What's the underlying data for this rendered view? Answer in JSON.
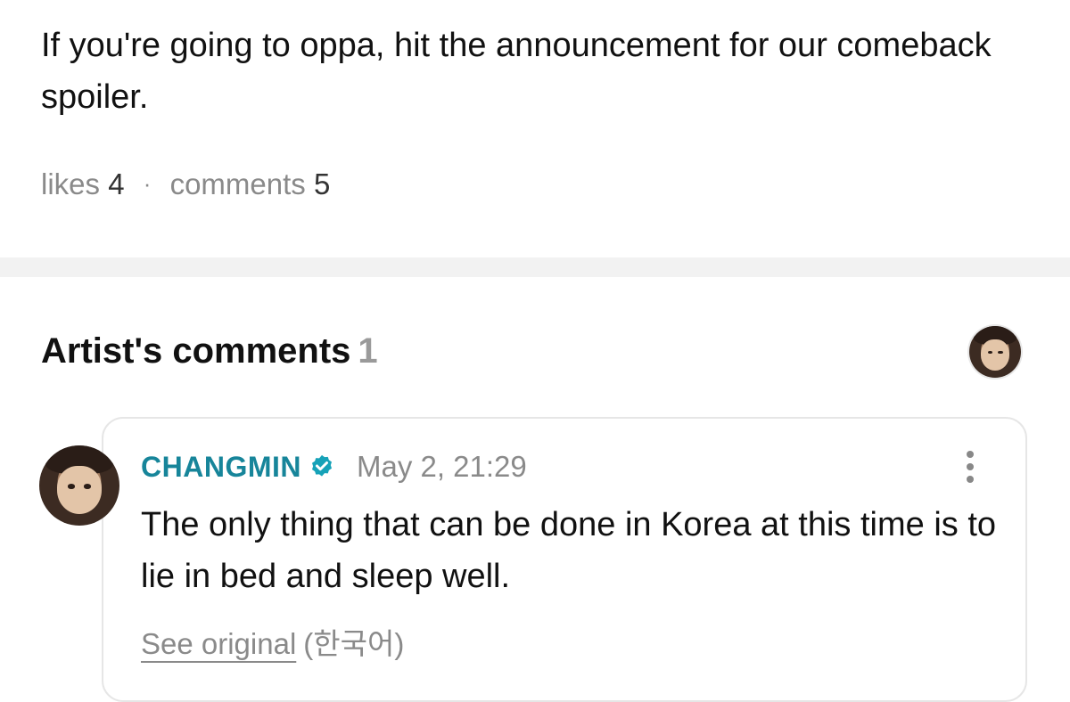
{
  "post": {
    "text": "If you're going to oppa, hit the announcement for our comeback spoiler.",
    "likes_label": "likes",
    "likes_count": "4",
    "separator": "·",
    "comments_label": "comments",
    "comments_count": "5"
  },
  "artist_comments": {
    "title": "Artist's comments",
    "count": "1",
    "comment": {
      "author": "CHANGMIN",
      "verified_icon": "verified-badge-icon",
      "timestamp": "May 2, 21:29",
      "text": "The only thing that can be done in Korea at this time is to lie in bed and sleep well.",
      "see_original_label": "See original",
      "language_label": "(한국어)"
    }
  },
  "colors": {
    "author": "#17859a",
    "verified": "#16a2b8",
    "muted": "#8a8a8a"
  }
}
